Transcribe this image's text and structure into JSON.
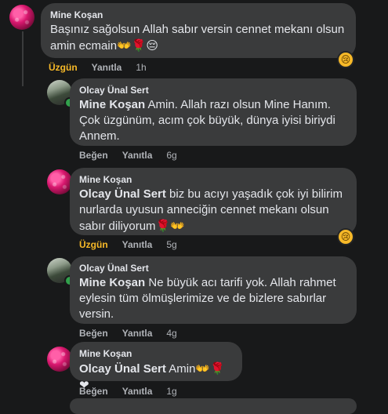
{
  "comments": [
    {
      "author": "Mine Koşan",
      "mention": "",
      "text": "Başınız sağolsun Allah sabır versin cennet mekanı olsun amin ecmain",
      "emoji": "👐🌹😔",
      "action_reaction": "Üzgün",
      "action_reply": "Yanıtla",
      "time": "1h",
      "reaction_icon": "😢"
    },
    {
      "author": "Olcay Ünal Sert",
      "mention": "Mine Koşan",
      "text": " Amin. Allah razı olsun Mine Hanım. Çok üzgünüm, acım çok büyük, dünya iyisi biriydi Annem.",
      "emoji": "",
      "action_reaction": "Beğen",
      "action_reply": "Yanıtla",
      "time": "6g"
    },
    {
      "author": "Mine Koşan",
      "mention": "Olcay Ünal Sert",
      "text": " biz bu acıyı yaşadık çok iyi bilirim nurlarda uyusun anneciğin cennet mekanı olsun sabır diliyorum",
      "emoji": "🌹👐",
      "action_reaction": "Üzgün",
      "action_reply": "Yanıtla",
      "time": "5g",
      "reaction_icon": "😢"
    },
    {
      "author": "Olcay Ünal Sert",
      "mention": "Mine Koşan",
      "text": " Ne büyük acı tarifi yok. Allah rahmet eylesin tüm ölmüşlerimize ve de bizlere sabırlar versin.",
      "emoji": "",
      "action_reaction": "Beğen",
      "action_reply": "Yanıtla",
      "time": "4g"
    },
    {
      "author": "Mine Koşan",
      "mention": "Olcay Ünal Sert",
      "text": " Amin",
      "emoji": "👐🌹❤",
      "action_reaction": "Beğen",
      "action_reply": "Yanıtla",
      "time": "1g"
    }
  ]
}
